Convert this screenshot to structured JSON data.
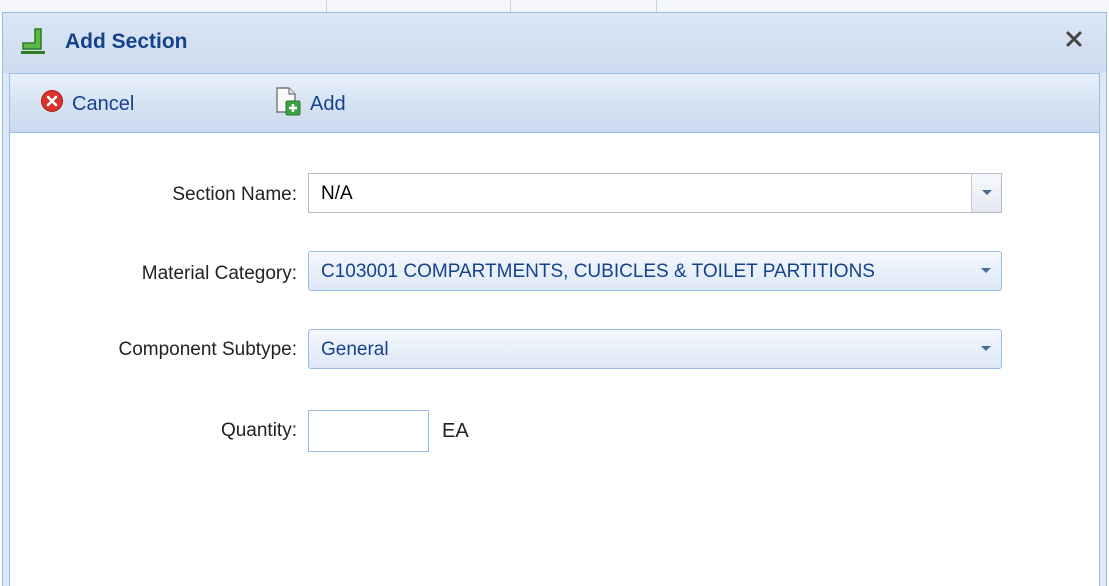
{
  "dialog": {
    "title": "Add Section",
    "close_label": "x"
  },
  "toolbar": {
    "cancel_label": "Cancel",
    "add_label": "Add"
  },
  "form": {
    "section_name": {
      "label": "Section Name:",
      "value": "N/A"
    },
    "material_category": {
      "label": "Material Category:",
      "value": "C103001 COMPARTMENTS, CUBICLES & TOILET PARTITIONS"
    },
    "component_subtype": {
      "label": "Component Subtype:",
      "value": "General"
    },
    "quantity": {
      "label": "Quantity:",
      "value": "",
      "unit": "EA"
    }
  },
  "colors": {
    "title_text": "#15428b",
    "panel_border": "#99bbe8",
    "cancel_icon": "#d9342b",
    "add_icon_plus": "#3aa346",
    "title_icon": "#4aa63a"
  },
  "icons": {
    "title": "section-icon",
    "close": "close-icon",
    "cancel": "cancel-icon",
    "add": "add-document-icon",
    "dropdown": "chevron-down-icon"
  }
}
